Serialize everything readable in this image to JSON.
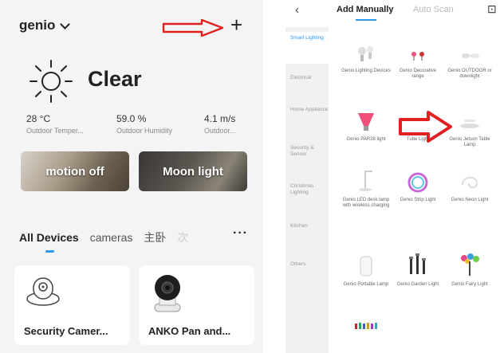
{
  "left": {
    "home_name": "genio",
    "add_icon": "plus-icon",
    "weather": "Clear",
    "stats": [
      {
        "value": "28 °C",
        "label": "Outdoor Temper..."
      },
      {
        "value": "59.0 %",
        "label": "Outdoor Humidity"
      },
      {
        "value": "4.1 m/s",
        "label": "Outdoor..."
      }
    ],
    "scenes": [
      "motion off",
      "Moon light"
    ],
    "tabs": [
      "All Devices",
      "cameras",
      "主卧",
      "次"
    ],
    "more": "···",
    "devices": [
      "Security Camer...",
      "ANKO Pan and..."
    ],
    "colors": {
      "accent": "#2b9af3",
      "arrow": "#e02020"
    }
  },
  "right": {
    "back": "‹",
    "tabs": [
      "Add Manually",
      "Auto Scan"
    ],
    "scan_icon": "⊡",
    "categories": [
      "Smart Lighting",
      "Electrical",
      "Home Appliance",
      "Security & Sensor",
      "Christmas Lighting",
      "Kitchen",
      "Others"
    ],
    "products": [
      "Genio Lighting Devices",
      "Genio Decorative range",
      "Genio OUTDOOR or downlight",
      "Genio PAR38 light",
      "Tube Light",
      "Genio Jetson Table Lamp",
      "Genio LED desk lamp with wireless charging",
      "Genio Strip Light",
      "Genio Neon Light",
      "Genio Portable Lamp",
      "Genio Garden Light",
      "Genio Fairy Light"
    ]
  }
}
